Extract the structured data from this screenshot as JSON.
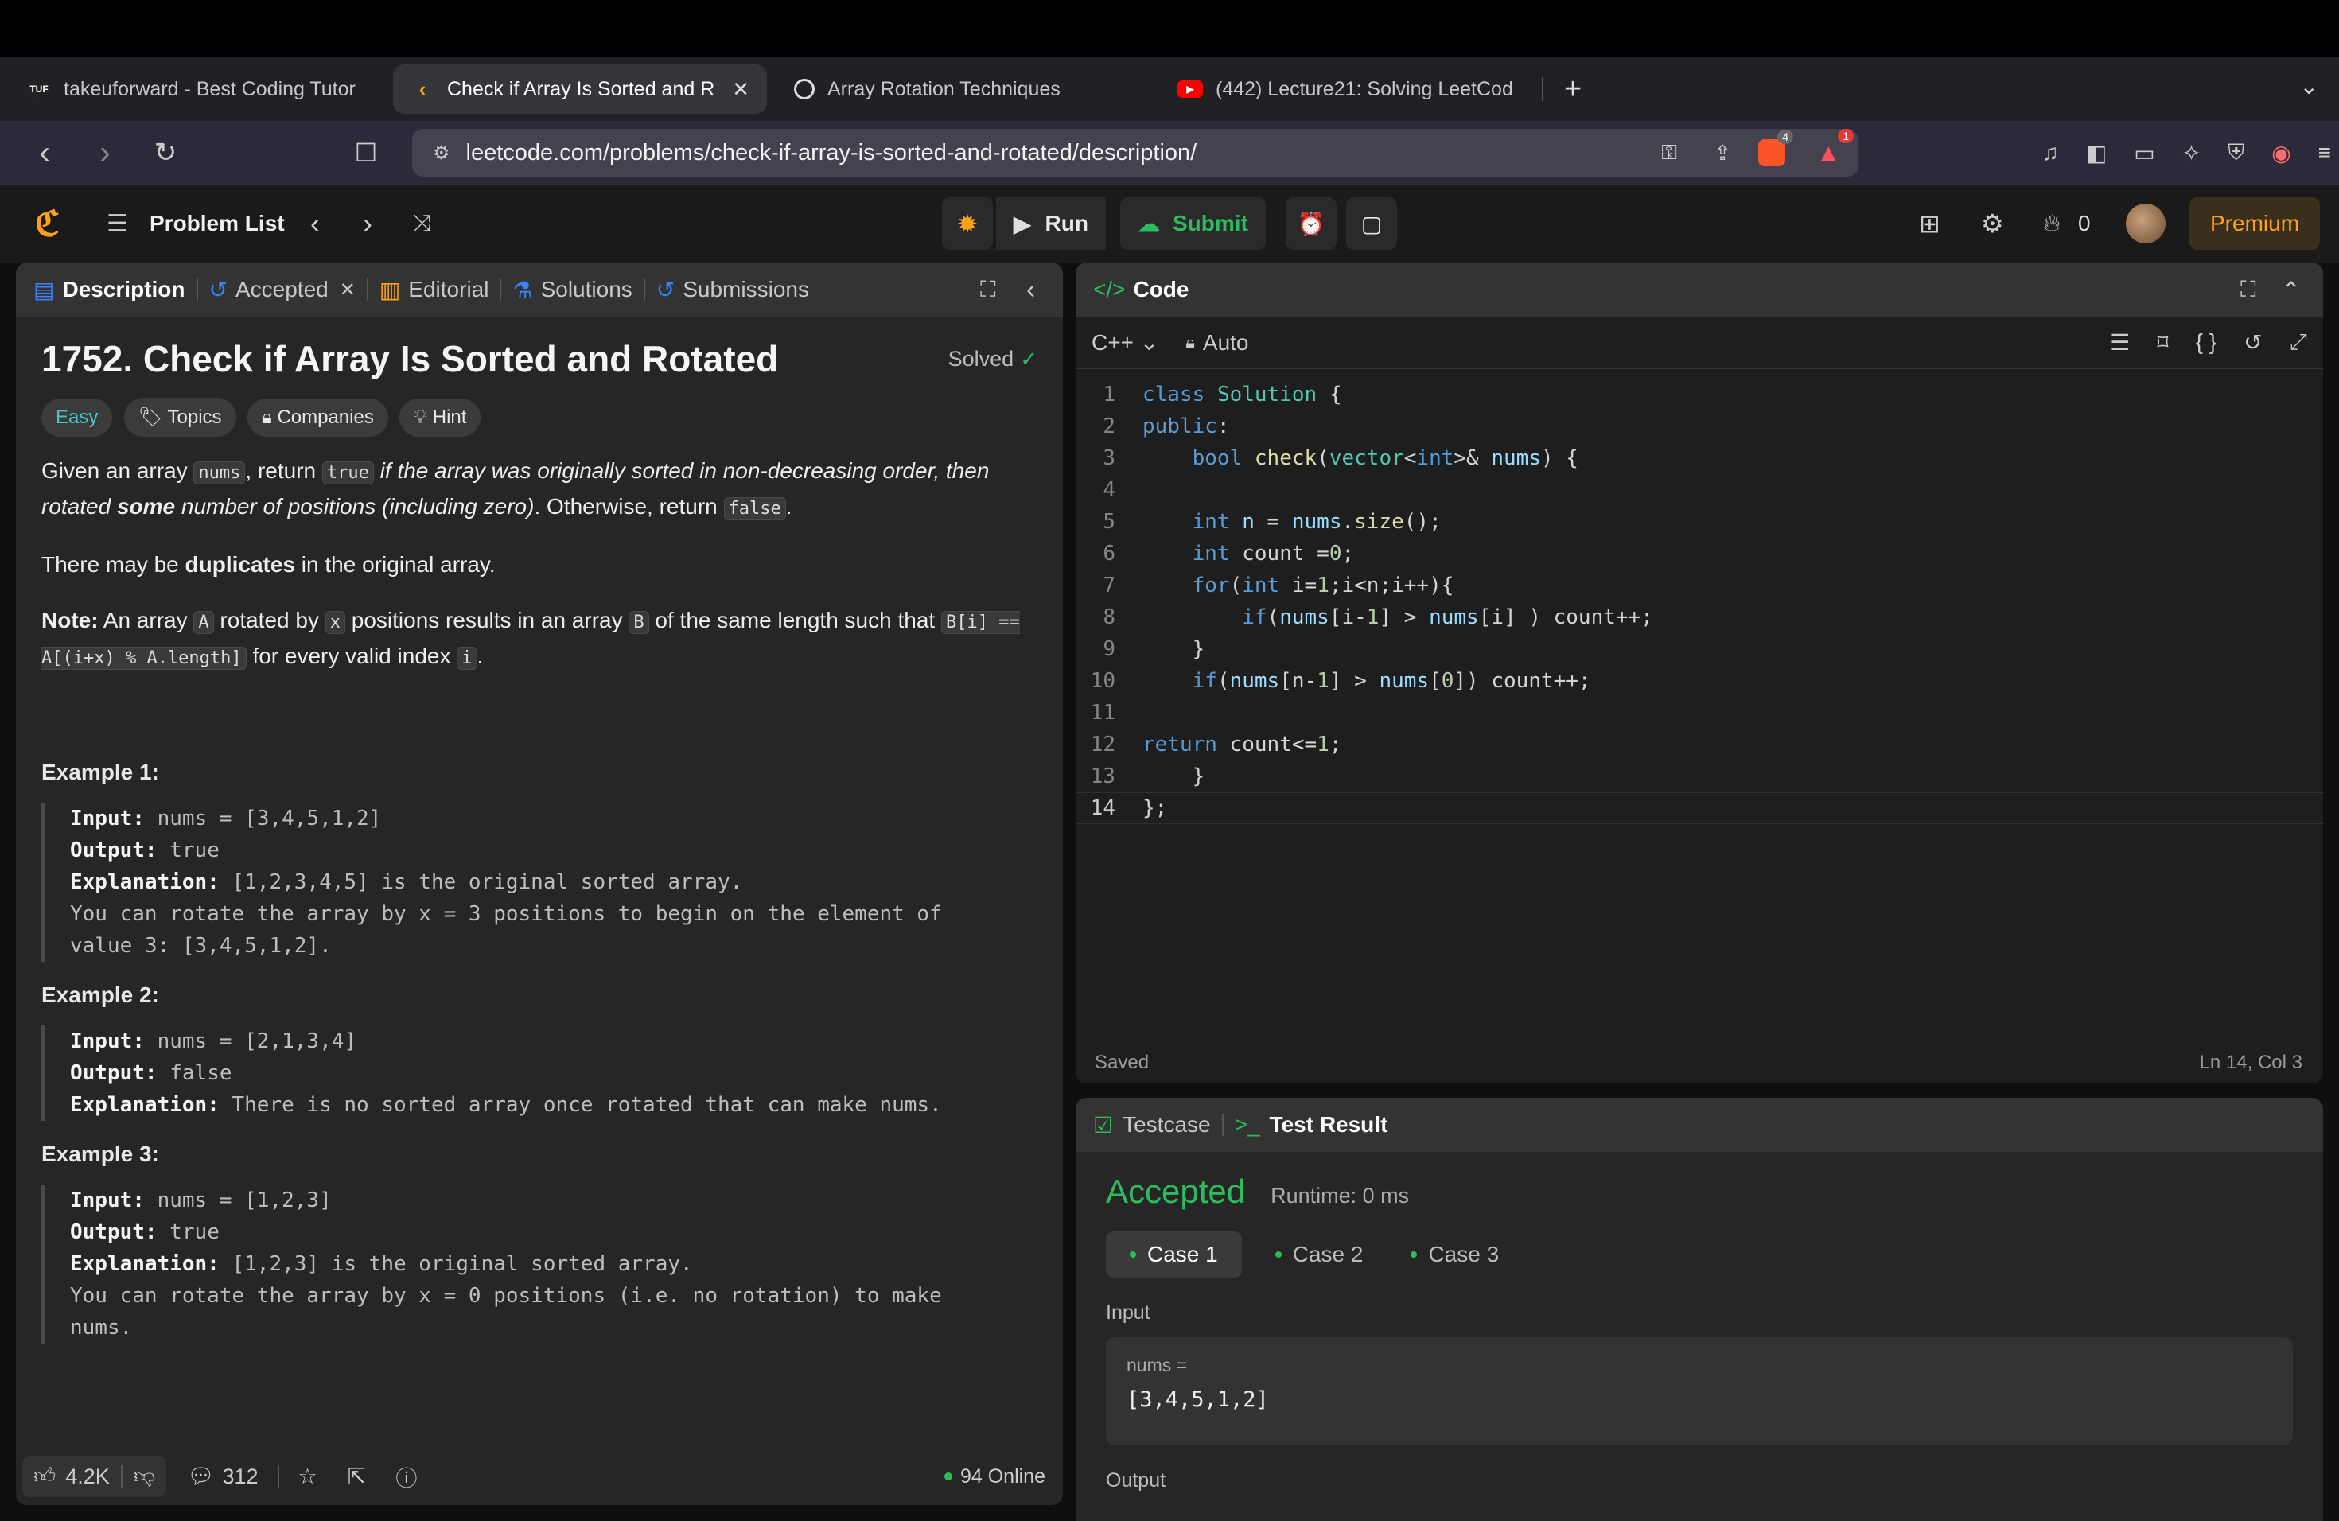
{
  "browser": {
    "tabs": [
      {
        "title": "takeuforward - Best Coding Tutor",
        "icon": "tuf-icon",
        "active": false
      },
      {
        "title": "Check if Array Is Sorted and R",
        "icon": "leetcode-icon",
        "active": true
      },
      {
        "title": "Array Rotation Techniques",
        "icon": "openai-icon",
        "active": false
      },
      {
        "title": "(442) Lecture21: Solving LeetCod",
        "icon": "youtube-icon",
        "active": false
      }
    ],
    "url": "leetcode.com/problems/check-if-array-is-sorted-and-rotated/description/",
    "brave_badge": "4",
    "alert_badge": "1"
  },
  "lc": {
    "problem_list": "Problem List",
    "run": "Run",
    "submit": "Submit",
    "streak": "0",
    "premium": "Premium"
  },
  "left": {
    "tabs": {
      "description": "Description",
      "accepted": "Accepted",
      "editorial": "Editorial",
      "solutions": "Solutions",
      "submissions": "Submissions"
    },
    "title": "1752. Check if Array Is Sorted and Rotated",
    "solved": "Solved",
    "tags": {
      "easy": "Easy",
      "topics": "Topics",
      "companies": "Companies",
      "hint": "Hint"
    },
    "p1": {
      "a": "Given an array ",
      "nums": "nums",
      "b": ", return ",
      "true": "true",
      "c": " if the array was originally sorted in non-decreasing order, then rotated ",
      "some": "some",
      "d": " number of positions (including zero)",
      "e": ". Otherwise, return ",
      "false": "false",
      "f": "."
    },
    "p2": {
      "a": "There may be ",
      "b": "duplicates",
      "c": " in the original array."
    },
    "p3": {
      "note": "Note:",
      "a": " An array ",
      "A": "A",
      "b": " rotated by ",
      "x": "x",
      "c": " positions results in an array ",
      "B": "B",
      "d": " of the same length such that ",
      "code": "B[i] == A[(i+x) % A.length]",
      "e": " for every valid index ",
      "i": "i",
      "f": "."
    },
    "examples": [
      {
        "title": "Example 1:",
        "input_label": "Input:",
        "input": " nums = [3,4,5,1,2]",
        "output_label": "Output:",
        "output": " true",
        "expl_label": "Explanation:",
        "expl": " [1,2,3,4,5] is the original sorted array.",
        "expl2": "You can rotate the array by x = 3 positions to begin on the element of",
        "expl3": "value 3: [3,4,5,1,2]."
      },
      {
        "title": "Example 2:",
        "input_label": "Input:",
        "input": " nums = [2,1,3,4]",
        "output_label": "Output:",
        "output": " false",
        "expl_label": "Explanation:",
        "expl": " There is no sorted array once rotated that can make nums."
      },
      {
        "title": "Example 3:",
        "input_label": "Input:",
        "input": " nums = [1,2,3]",
        "output_label": "Output:",
        "output": " true",
        "expl_label": "Explanation:",
        "expl": " [1,2,3] is the original sorted array.",
        "expl2": "You can rotate the array by x = 0 positions (i.e. no rotation) to make",
        "expl3": "nums."
      }
    ],
    "footer": {
      "likes": "4.2K",
      "comments": "312",
      "online": "94 Online"
    }
  },
  "code": {
    "title": "Code",
    "language": "C++",
    "mode": "Auto",
    "status": "Saved",
    "cursor": "Ln 14, Col 3"
  },
  "test": {
    "tab_testcase": "Testcase",
    "tab_result": "Test Result",
    "verdict": "Accepted",
    "runtime": "Runtime: 0 ms",
    "cases": [
      "Case 1",
      "Case 2",
      "Case 3"
    ],
    "input_label": "Input",
    "var_name": "nums =",
    "var_value": "[3,4,5,1,2]",
    "next_label": "Output"
  },
  "colors": {
    "accent_green": "#2cbb5d",
    "easy": "#46c6c2",
    "premium": "#ffa116"
  }
}
